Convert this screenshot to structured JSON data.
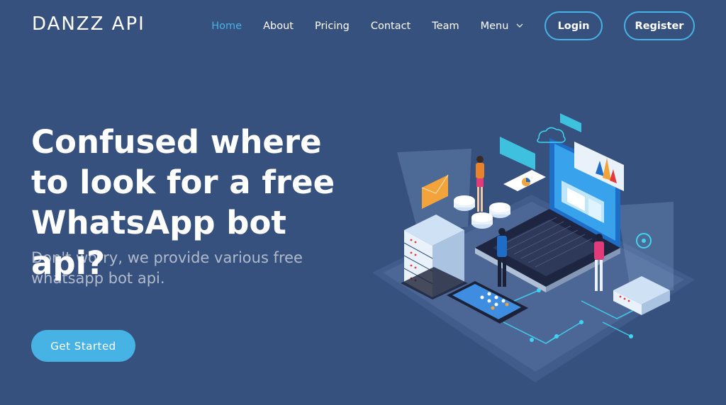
{
  "brand": {
    "logo": "DANZZ API"
  },
  "nav": {
    "items": [
      {
        "label": "Home",
        "active": true
      },
      {
        "label": "About"
      },
      {
        "label": "Pricing"
      },
      {
        "label": "Contact"
      },
      {
        "label": "Team"
      },
      {
        "label": "Menu",
        "icon": "chevron-down-icon"
      }
    ],
    "login_label": "Login",
    "register_label": "Register"
  },
  "hero": {
    "title": "Confused where to look for a free WhatsApp bot api?",
    "subtitle": "Don't worry, we provide various free whatsapp bot api.",
    "cta_label": "Get Started"
  },
  "colors": {
    "background": "#37517e",
    "accent": "#47b2e4",
    "text": "#ffffff"
  }
}
